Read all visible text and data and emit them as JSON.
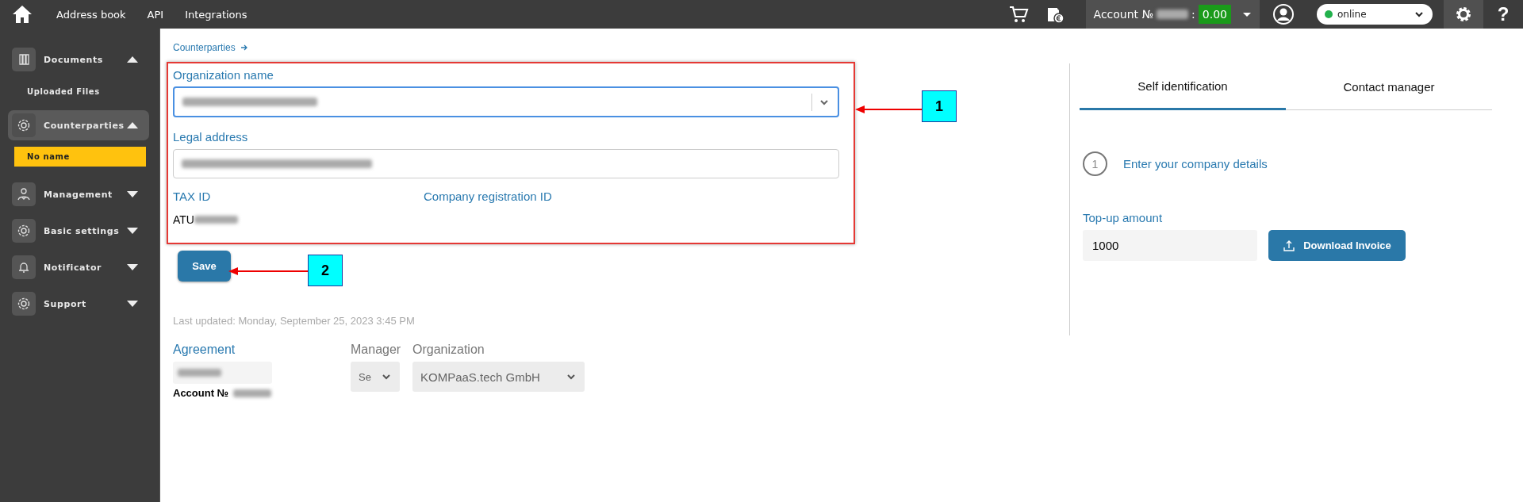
{
  "topbar": {
    "nav_links": [
      "Address book",
      "API",
      "Integrations"
    ],
    "account": {
      "label": "Account №",
      "separator": ":",
      "balance": "0.00"
    },
    "status_select": {
      "value": "online"
    },
    "help": "?"
  },
  "sidebar": {
    "items": [
      {
        "label": "Documents",
        "expanded": true,
        "selected": false,
        "children": [
          {
            "label": "Uploaded Files",
            "selected": false
          }
        ]
      },
      {
        "label": "Counterparties",
        "expanded": true,
        "selected": true,
        "children": [
          {
            "label": "No name",
            "selected": true
          }
        ]
      },
      {
        "label": "Management",
        "expanded": false,
        "selected": false
      },
      {
        "label": "Basic settings",
        "expanded": false,
        "selected": false
      },
      {
        "label": "Notificator",
        "expanded": false,
        "selected": false
      },
      {
        "label": "Support",
        "expanded": false,
        "selected": false
      }
    ]
  },
  "breadcrumb": "Counterparties",
  "form": {
    "organization_name": {
      "label": "Organization name"
    },
    "legal_address": {
      "label": "Legal address"
    },
    "tax_id": {
      "label": "TAX ID",
      "value": "ATU"
    },
    "company_registration_id": {
      "label": "Company registration ID"
    },
    "save_button": "Save"
  },
  "callouts": [
    {
      "number": "1"
    },
    {
      "number": "2"
    }
  ],
  "last_updated": "Last updated: Monday, September 25, 2023 3:45 PM",
  "agreement": {
    "label": "Agreement"
  },
  "manager": {
    "label": "Manager",
    "value": "Se"
  },
  "organization": {
    "label": "Organization",
    "value": "KOMPaaS.tech GmbH"
  },
  "account_label": "Account №",
  "right_panel": {
    "tabs": [
      {
        "label": "Self identification",
        "selected": true
      },
      {
        "label": "Contact manager",
        "selected": false
      }
    ],
    "step": {
      "number": "1",
      "label": "Enter your company details"
    },
    "topup": {
      "label": "Top-up amount",
      "value": "1000"
    },
    "download_button": "Download Invoice"
  }
}
